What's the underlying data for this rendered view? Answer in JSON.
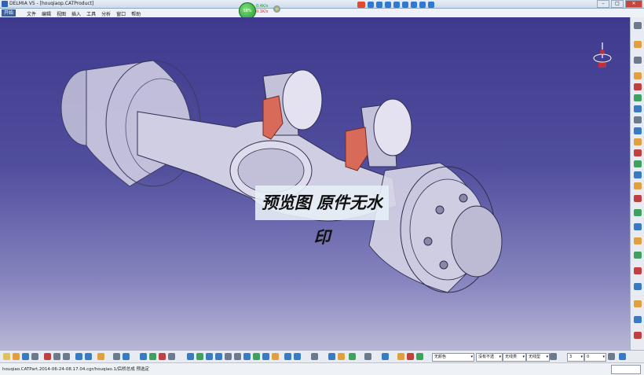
{
  "window": {
    "title": "DELMIA V5 - [houqiaop.CATProduct]",
    "controls": [
      "–",
      "□",
      "✕"
    ]
  },
  "menubar": {
    "start_label": "开始",
    "items": [
      "文件",
      "编辑",
      "视图",
      "插入",
      "工具",
      "分析",
      "窗口",
      "帮助"
    ]
  },
  "tray": {
    "gauge_percent": "58%",
    "upload_speed": "0.4K/s",
    "download_speed": "0.1K/s"
  },
  "viewport": {
    "watermark_text": "预览图 原件无水印",
    "background_top": "#3e3a8e",
    "background_bottom": "#b9b7d6",
    "part_color": "#d2d0e2",
    "highlight_color": "#d86a5a"
  },
  "bottom_toolbar": {
    "selectors": [
      "无颜色",
      "没有不透",
      "无线类",
      "无线型",
      "3",
      "0"
    ]
  },
  "statusbar": {
    "path_text": "houqiao.CATPart.2014-06-24-08.17.04.cgr/houqiao.1/后桥总成 预选定"
  }
}
